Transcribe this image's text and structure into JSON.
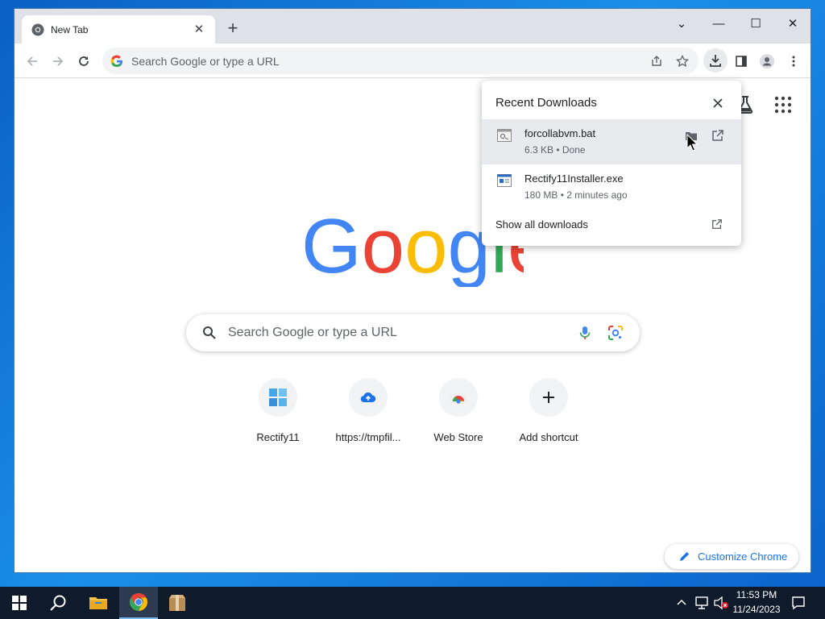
{
  "tab": {
    "title": "New Tab",
    "close": "✕"
  },
  "new_tab": "+",
  "window_controls": {
    "dropdown": "⌄",
    "minimize": "—",
    "maximize": "☐",
    "close": "✕"
  },
  "toolbar": {
    "omnibox_placeholder": "Search Google or type a URL"
  },
  "content": {
    "search_placeholder": "Search Google or type a URL",
    "shortcuts": [
      {
        "label": "Rectify11",
        "icon": "windows-logo-icon"
      },
      {
        "label": "https://tmpfil...",
        "icon": "cloud-upload-icon"
      },
      {
        "label": "Web Store",
        "icon": "web-store-icon"
      },
      {
        "label": "Add shortcut",
        "icon": "plus-icon"
      }
    ],
    "customize_label": "Customize Chrome"
  },
  "downloads": {
    "header": "Recent Downloads",
    "items": [
      {
        "name": "forcollabvm.bat",
        "status": "6.3 KB • Done"
      },
      {
        "name": "Rectify11Installer.exe",
        "status": "180 MB • 2 minutes ago"
      }
    ],
    "show_all": "Show all downloads"
  },
  "taskbar": {
    "time": "11:53 PM",
    "date": "11/24/2023"
  },
  "colors": {
    "accent": "#1a73e8",
    "google_blue": "#4285f4",
    "google_red": "#ea4335",
    "google_yellow": "#fbbc05",
    "google_green": "#34a853"
  }
}
